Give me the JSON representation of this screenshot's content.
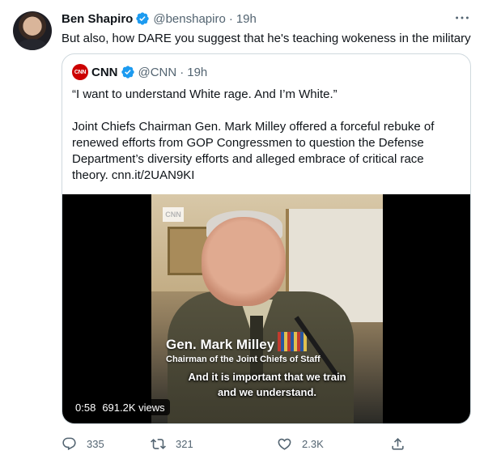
{
  "author": {
    "name": "Ben Shapiro",
    "handle": "@benshapiro",
    "separator": "·",
    "time": "19h",
    "avatar_icon": "avatar-photo"
  },
  "tweet": {
    "text": "But also, how DARE you suggest that he's teaching wokeness in the military"
  },
  "quoted": {
    "name": "CNN",
    "handle": "@CNN",
    "separator": "·",
    "time": "19h",
    "logo_text": "CNN",
    "quote_line": "“I want to understand White rage. And I’m White.”",
    "body": "Joint Chiefs Chairman Gen. Mark Milley offered a forceful rebuke of renewed efforts from GOP Congressmen to question the Defense Department’s diversity efforts and alleged embrace of critical race theory. cnn.it/2UAN9KI",
    "video": {
      "watermark": "CNN",
      "lower_third_name": "Gen. Mark Milley",
      "lower_third_title": "Chairman of the Joint Chiefs of Staff",
      "caption_line1": "And it is important that we train",
      "caption_line2": "and we understand.",
      "duration": "0:58",
      "views": "691.2K views"
    }
  },
  "actions": {
    "reply_count": "335",
    "retweet_count": "321",
    "like_count": "2.3K",
    "icons": [
      "reply-icon",
      "retweet-icon",
      "like-icon",
      "share-icon"
    ]
  },
  "colors": {
    "text": "#0f1419",
    "secondary": "#536471",
    "verified": "#1d9bf0",
    "border": "#cfd9de",
    "cnn_red": "#cc0000"
  }
}
